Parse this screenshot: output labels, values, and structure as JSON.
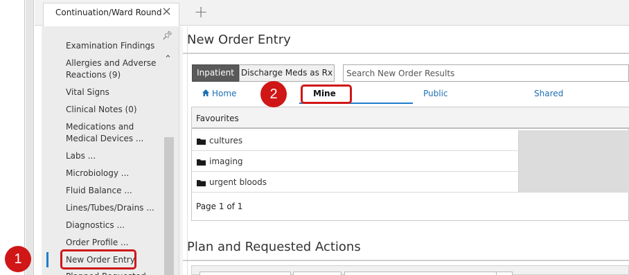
{
  "tabs": [
    {
      "label": "Continuation/Ward Round"
    }
  ],
  "icons": {
    "close": "close-icon",
    "add_tab": "plus-icon",
    "pin": "pin-icon",
    "collapse": "chevron-up-icon",
    "home": "home-icon",
    "folder": "folder-icon"
  },
  "sidebar": {
    "items": [
      {
        "label": "Examination Findings"
      },
      {
        "label": "Allergies and Adverse Reactions (9)"
      },
      {
        "label": "Vital Signs"
      },
      {
        "label": "Clinical Notes (0)"
      },
      {
        "label": "Medications and Medical Devices ..."
      },
      {
        "label": "Labs ..."
      },
      {
        "label": "Microbiology ..."
      },
      {
        "label": "Fluid Balance ..."
      },
      {
        "label": "Lines/Tubes/Drains ..."
      },
      {
        "label": "Diagnostics ..."
      },
      {
        "label": "Order Profile ..."
      },
      {
        "label": "New Order Entry"
      },
      {
        "label": "Planned Requested"
      }
    ],
    "active_item": "New Order Entry"
  },
  "main": {
    "title": "New Order Entry",
    "mode_buttons": [
      {
        "label": "Inpatient"
      },
      {
        "label": "Discharge Meds as Rx"
      }
    ],
    "search_placeholder": "Search New Order Results",
    "subtabs": [
      {
        "label": "Home"
      },
      {
        "label": "Mine"
      },
      {
        "label": "Public"
      },
      {
        "label": "Shared"
      }
    ],
    "selected_subtab": "Mine",
    "favourites": {
      "header": "Favourites",
      "rows": [
        {
          "label": "cultures"
        },
        {
          "label": "imaging"
        },
        {
          "label": "urgent bloods"
        }
      ],
      "pager": "Page 1 of 1"
    },
    "plan_title": "Plan and Requested Actions"
  },
  "annotations": {
    "step1": "1",
    "step2": "2"
  },
  "colors": {
    "accent": "#1f7dc9",
    "annotation": "#d01616",
    "active_button": "#5a5a5a"
  }
}
